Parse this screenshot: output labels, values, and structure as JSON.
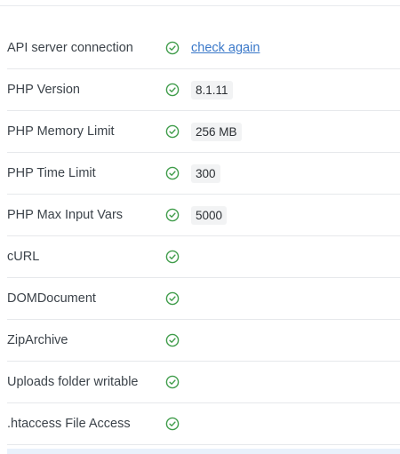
{
  "status_rows": [
    {
      "label": "API server connection",
      "status": "ok",
      "link": "check again"
    },
    {
      "label": "PHP Version",
      "status": "ok",
      "value": "8.1.11"
    },
    {
      "label": "PHP Memory Limit",
      "status": "ok",
      "value": "256 MB"
    },
    {
      "label": "PHP Time Limit",
      "status": "ok",
      "value": "300"
    },
    {
      "label": "PHP Max Input Vars",
      "status": "ok",
      "value": "5000"
    },
    {
      "label": "cURL",
      "status": "ok"
    },
    {
      "label": "DOMDocument",
      "status": "ok"
    },
    {
      "label": "ZipArchive",
      "status": "ok"
    },
    {
      "label": "Uploads folder writable",
      "status": "ok"
    },
    {
      "label": ".htaccess File Access",
      "status": "ok"
    }
  ],
  "colors": {
    "check_green": "#3f9c4a",
    "link_blue": "#3a78c9",
    "label_text": "#3c434a"
  },
  "icons": {
    "status_ok": "check-circle-icon"
  }
}
